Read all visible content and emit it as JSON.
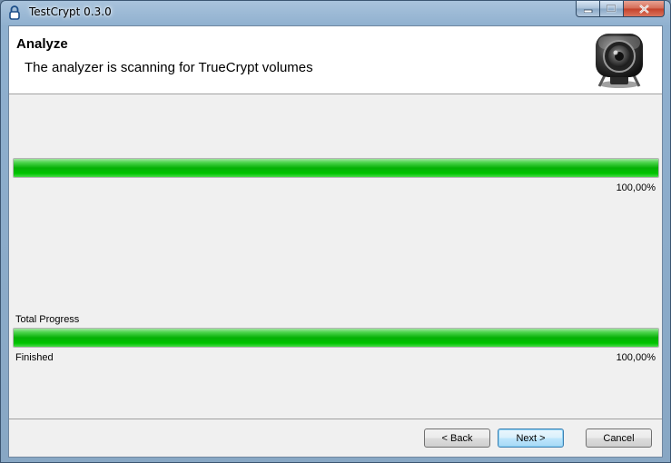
{
  "window": {
    "title": "TestCrypt 0.3.0"
  },
  "header": {
    "title": "Analyze",
    "subtitle": "The analyzer is scanning for TrueCrypt volumes"
  },
  "progress_current": {
    "fraction": 1.0,
    "percent_text": "100,00%"
  },
  "progress_total": {
    "label": "Total Progress",
    "fraction": 1.0,
    "status": "Finished",
    "percent_text": "100,00%"
  },
  "buttons": {
    "back": "< Back",
    "next": "Next >",
    "cancel": "Cancel"
  },
  "icons": {
    "app": "lock-icon",
    "logo": "webcam-lens-icon",
    "minimize": "minimize-icon",
    "maximize": "maximize-icon",
    "close": "close-icon"
  },
  "colors": {
    "progress_fill": "#06b006",
    "title_bar": "#8fb0cf",
    "close_button": "#c4412a"
  }
}
